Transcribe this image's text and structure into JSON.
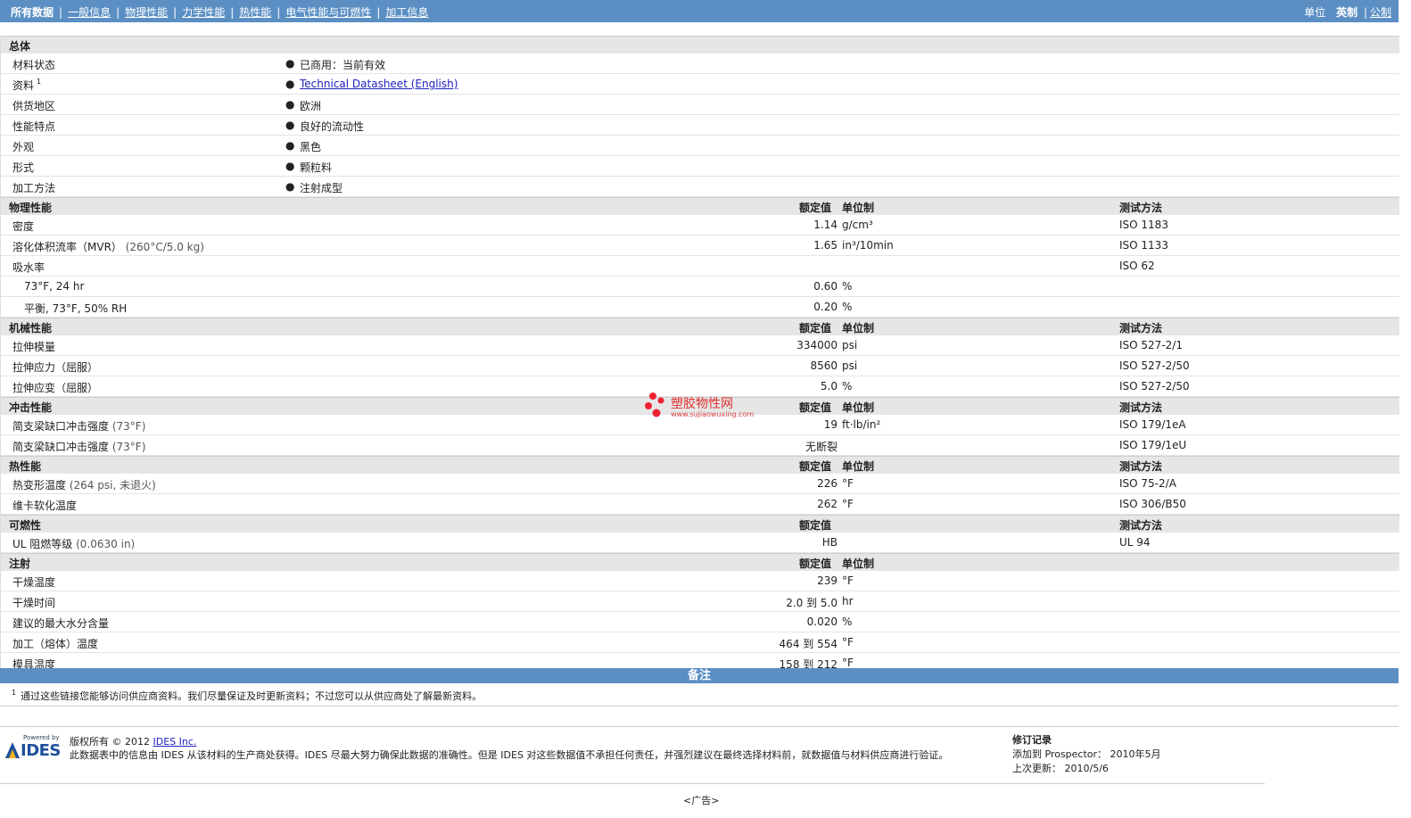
{
  "nav": {
    "items": [
      "所有数据",
      "一般信息",
      "物理性能",
      "力学性能",
      "热性能",
      "电气性能与可燃性",
      "加工信息"
    ],
    "units_label": "单位",
    "imperial": "英制",
    "metric": "公制"
  },
  "general": {
    "title": "总体",
    "rows": [
      {
        "label": "材料状态",
        "value": "已商用：当前有效"
      },
      {
        "label": "资料",
        "sup": "1",
        "value": "Technical Datasheet (English)"
      },
      {
        "label": "供货地区",
        "value": "欧洲"
      },
      {
        "label": "性能特点",
        "value": "良好的流动性"
      },
      {
        "label": "外观",
        "value": "黑色"
      },
      {
        "label": "形式",
        "value": "颗粒料"
      },
      {
        "label": "加工方法",
        "value": "注射成型"
      }
    ]
  },
  "headers": {
    "nominal": "额定值",
    "unit": "单位制",
    "method": "测试方法"
  },
  "physical": {
    "title": "物理性能",
    "rows": [
      {
        "label": "密度",
        "value": "1.14",
        "unit": "g/cm³",
        "method": "ISO 1183"
      },
      {
        "label": "溶化体积流率（MVR）",
        "note": "(260°C/5.0 kg)",
        "value": "1.65",
        "unit": "in³/10min",
        "method": "ISO 1133"
      },
      {
        "label": "吸水率",
        "value": "",
        "unit": "",
        "method": "ISO 62"
      },
      {
        "label": "73°F, 24 hr",
        "sub": true,
        "value": "0.60",
        "unit": "%",
        "method": ""
      },
      {
        "label": "平衡, 73°F, 50% RH",
        "sub": true,
        "value": "0.20",
        "unit": "%",
        "method": ""
      }
    ]
  },
  "mechanical": {
    "title": "机械性能",
    "rows": [
      {
        "label": "拉伸模量",
        "value": "334000",
        "unit": "psi",
        "method": "ISO 527-2/1"
      },
      {
        "label": "拉伸应力（屈服）",
        "value": "8560",
        "unit": "psi",
        "method": "ISO 527-2/50"
      },
      {
        "label": "拉伸应变（屈服）",
        "value": "5.0",
        "unit": "%",
        "method": "ISO 527-2/50"
      }
    ]
  },
  "impact": {
    "title": "冲击性能",
    "rows": [
      {
        "label": "简支梁缺口冲击强度",
        "note": "(73°F)",
        "value": "19",
        "unit": "ft·lb/in²",
        "method": "ISO 179/1eA"
      },
      {
        "label": "简支梁缺口冲击强度",
        "note": "(73°F)",
        "value": "无断裂",
        "unit": "",
        "method": "ISO 179/1eU"
      }
    ]
  },
  "thermal": {
    "title": "热性能",
    "rows": [
      {
        "label": "热变形温度",
        "note": "(264 psi, 未退火)",
        "value": "226",
        "unit": "°F",
        "method": "ISO 75-2/A"
      },
      {
        "label": "维卡软化温度",
        "value": "262",
        "unit": "°F",
        "method": "ISO 306/B50"
      }
    ]
  },
  "flammability": {
    "title": "可燃性",
    "rows": [
      {
        "label": "UL 阻燃等级",
        "note": "(0.0630 in)",
        "value": "HB",
        "unit": "",
        "method": "UL 94"
      }
    ]
  },
  "injection": {
    "title": "注射",
    "rows": [
      {
        "label": "干燥温度",
        "value": "239",
        "unit": "°F"
      },
      {
        "label": "干燥时间",
        "value": "2.0 到  5.0",
        "unit": "hr"
      },
      {
        "label": "建议的最大水分含量",
        "value": "0.020",
        "unit": "%"
      },
      {
        "label": "加工（熔体）温度",
        "value": "464 到  554",
        "unit": "°F"
      },
      {
        "label": "模具温度",
        "value": "158 到  212",
        "unit": "°F"
      }
    ]
  },
  "notes": {
    "title": "备注",
    "sup": "1",
    "text": "通过这些链接您能够访问供应商资料。我们尽量保证及时更新资料；不过您可以从供应商处了解最新资料。"
  },
  "footer": {
    "logo_small": "Powered by",
    "logo_big": "IDES",
    "copyright": "版权所有 © 2012",
    "company": "IDES Inc.",
    "disclaimer": "此数据表中的信息由 IDES 从该材料的生产商处获得。IDES 尽最大努力确保此数据的准确性。但是 IDES 对这些数据值不承担任何责任，并强烈建议在最终选择材料前，就数据值与材料供应商进行验证。",
    "revision_title": "修订记录",
    "added_to": "添加到 Prospector： 2010年5月",
    "last_updated": "上次更新： 2010/5/6",
    "ad": "<广告>"
  },
  "watermark": {
    "text": "塑胶物性网",
    "url": "www.sujiaowuxing.com"
  }
}
